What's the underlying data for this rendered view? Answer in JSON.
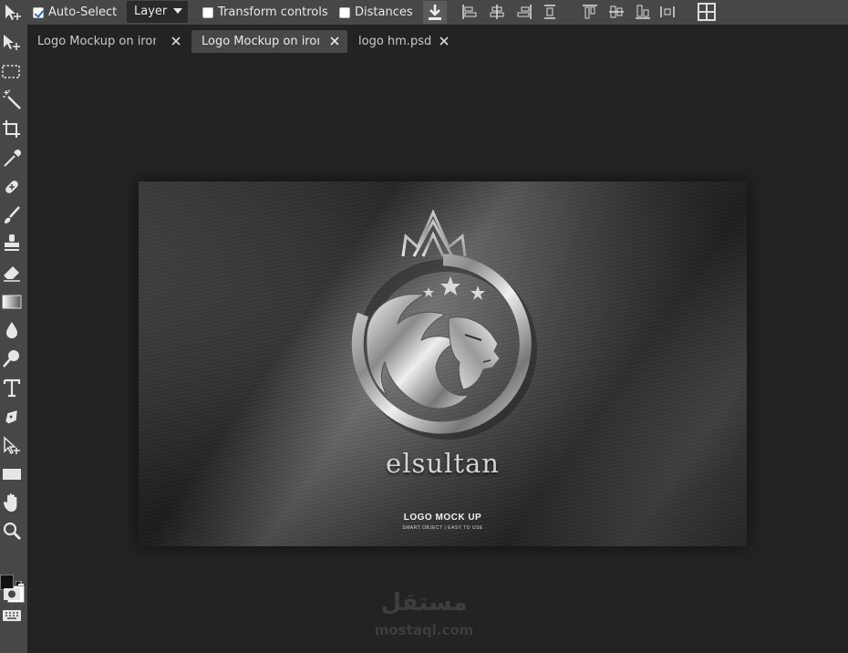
{
  "options_bar": {
    "auto_select_label": "Auto-Select",
    "auto_select_checked": true,
    "target_select_value": "Layer",
    "transform_controls_label": "Transform controls",
    "transform_controls_checked": false,
    "distances_label": "Distances",
    "distances_checked": false
  },
  "tabs": [
    {
      "label": "Logo Mockup on iron",
      "active": false
    },
    {
      "label": "Logo Mockup on iron",
      "active": true
    },
    {
      "label": "logo hm.psd",
      "active": false
    }
  ],
  "document": {
    "brand_text": "elsultan",
    "mock_title": "LOGO MOCK UP",
    "mock_subtitle": "SMART OBJECT | EASY TO USE"
  },
  "watermark": {
    "arabic": "مستقل",
    "latin": "mostaql.com"
  },
  "colors": {
    "foreground": "#111111",
    "background": "#ffffff",
    "panel": "#474747",
    "workspace": "#232323"
  }
}
